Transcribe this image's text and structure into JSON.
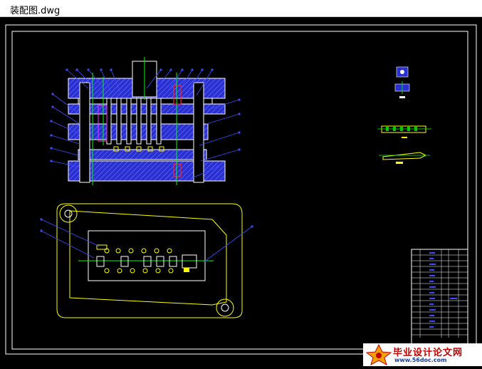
{
  "window": {
    "title": "装配图.dwg"
  },
  "watermark": {
    "main_text": "毕业设计论文网",
    "url_text": "www.56doc.com"
  },
  "colors": {
    "background": "#000000",
    "frame": "#ffffff",
    "hatch": "#3a4cff",
    "outline": "#ffffff",
    "yellow": "#ffff00",
    "green": "#00ff00",
    "leader": "#3a4cff",
    "red": "#ff2020"
  }
}
